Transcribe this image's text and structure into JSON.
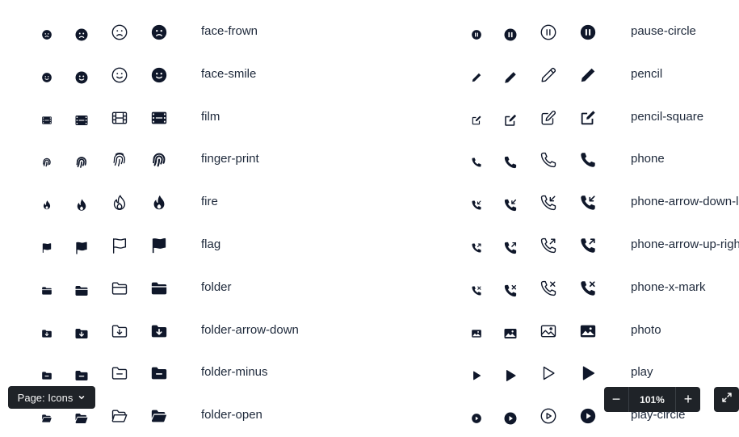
{
  "left_icons": [
    {
      "name": "face-frown",
      "icon": "face-frown-icon"
    },
    {
      "name": "face-smile",
      "icon": "face-smile-icon"
    },
    {
      "name": "film",
      "icon": "film-icon"
    },
    {
      "name": "finger-print",
      "icon": "finger-print-icon"
    },
    {
      "name": "fire",
      "icon": "fire-icon"
    },
    {
      "name": "flag",
      "icon": "flag-icon"
    },
    {
      "name": "folder",
      "icon": "folder-icon"
    },
    {
      "name": "folder-arrow-down",
      "icon": "folder-arrow-down-icon"
    },
    {
      "name": "folder-minus",
      "icon": "folder-minus-icon"
    },
    {
      "name": "folder-open",
      "icon": "folder-open-icon"
    }
  ],
  "right_icons": [
    {
      "name": "pause-circle",
      "icon": "pause-circle-icon"
    },
    {
      "name": "pencil",
      "icon": "pencil-icon"
    },
    {
      "name": "pencil-square",
      "icon": "pencil-square-icon"
    },
    {
      "name": "phone",
      "icon": "phone-icon"
    },
    {
      "name": "phone-arrow-down-left",
      "icon": "phone-arrow-down-left-icon"
    },
    {
      "name": "phone-arrow-up-right",
      "icon": "phone-arrow-up-right-icon"
    },
    {
      "name": "phone-x-mark",
      "icon": "phone-x-mark-icon"
    },
    {
      "name": "photo",
      "icon": "photo-icon"
    },
    {
      "name": "play",
      "icon": "play-icon"
    },
    {
      "name": "play-circle",
      "icon": "play-circle-icon"
    }
  ],
  "variants": [
    "mini-solid",
    "solid",
    "outline",
    "solid-large"
  ],
  "controls": {
    "page_label": "Page: Icons",
    "zoom_minus": "−",
    "zoom_value": "101%",
    "zoom_plus": "+",
    "fullscreen_icon": "expand-icon"
  },
  "colors": {
    "icon": "#0f172a",
    "control_bg": "#1f2328"
  }
}
